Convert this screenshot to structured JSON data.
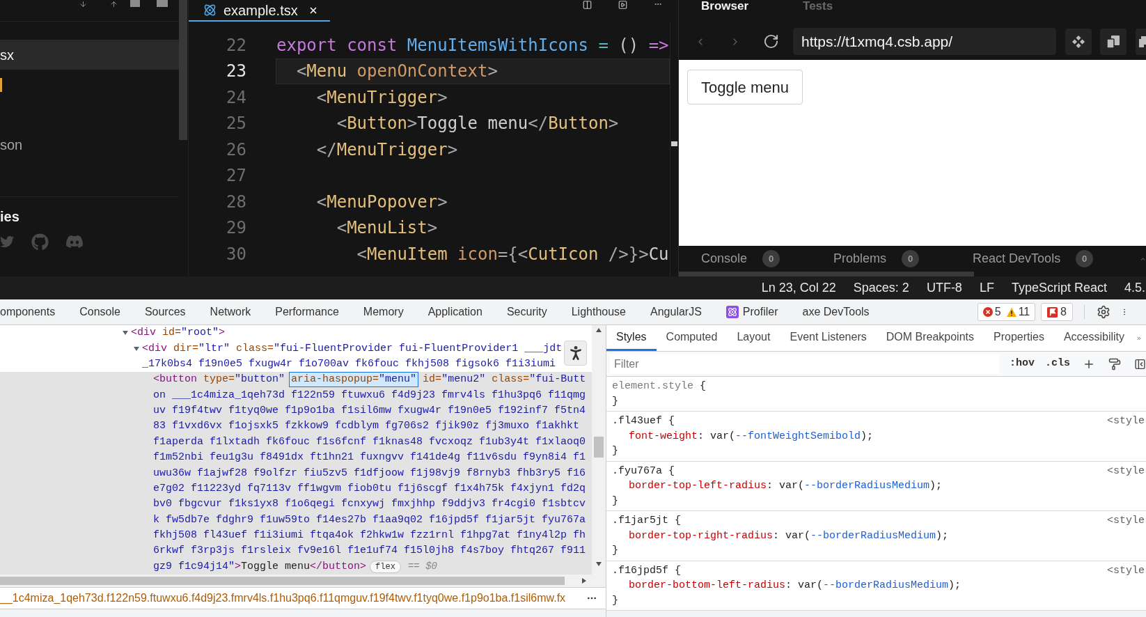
{
  "sidebar": {
    "files": [
      {
        "label": "sx",
        "selected": true
      },
      {
        "label": "son",
        "selected": false
      }
    ],
    "section_title": "ies"
  },
  "editor": {
    "tabs": [
      {
        "label": "example.tsx",
        "selected": true
      }
    ],
    "lines": [
      {
        "number": "22",
        "current": false,
        "tokens": [
          {
            "kind": "keyword",
            "text": "export const "
          },
          {
            "kind": "function",
            "text": "MenuItemsWithIcons"
          },
          {
            "kind": "operator",
            "text": " = "
          },
          {
            "kind": "plain",
            "text": "() "
          },
          {
            "kind": "keyword",
            "text": "=>"
          }
        ]
      },
      {
        "number": "23",
        "current": true,
        "tokens": [
          {
            "kind": "punct",
            "text": "  <"
          },
          {
            "kind": "component",
            "text": "Menu"
          },
          {
            "kind": "attribute",
            "text": " openOnContext"
          },
          {
            "kind": "punct",
            "text": ">"
          }
        ]
      },
      {
        "number": "24",
        "current": false,
        "tokens": [
          {
            "kind": "punct",
            "text": "    <"
          },
          {
            "kind": "component",
            "text": "MenuTrigger"
          },
          {
            "kind": "punct",
            "text": ">"
          }
        ]
      },
      {
        "number": "25",
        "current": false,
        "tokens": [
          {
            "kind": "punct",
            "text": "      <"
          },
          {
            "kind": "component",
            "text": "Button"
          },
          {
            "kind": "punct",
            "text": ">"
          },
          {
            "kind": "text",
            "text": "Toggle menu"
          },
          {
            "kind": "punct",
            "text": "</"
          },
          {
            "kind": "component",
            "text": "Button"
          },
          {
            "kind": "punct",
            "text": ">"
          }
        ]
      },
      {
        "number": "26",
        "current": false,
        "tokens": [
          {
            "kind": "punct",
            "text": "    </"
          },
          {
            "kind": "component",
            "text": "MenuTrigger"
          },
          {
            "kind": "punct",
            "text": ">"
          }
        ]
      },
      {
        "number": "27",
        "current": false
      },
      {
        "number": "28",
        "current": false,
        "tokens": [
          {
            "kind": "punct",
            "text": "    <"
          },
          {
            "kind": "component",
            "text": "MenuPopover"
          },
          {
            "kind": "punct",
            "text": ">"
          }
        ]
      },
      {
        "number": "29",
        "current": false,
        "tokens": [
          {
            "kind": "punct",
            "text": "      <"
          },
          {
            "kind": "component",
            "text": "MenuList"
          },
          {
            "kind": "punct",
            "text": ">"
          }
        ]
      },
      {
        "number": "30",
        "current": false,
        "tokens": [
          {
            "kind": "punct",
            "text": "        <"
          },
          {
            "kind": "component",
            "text": "MenuItem"
          },
          {
            "kind": "attribute",
            "text": " icon"
          },
          {
            "kind": "punct",
            "text": "={<"
          },
          {
            "kind": "component",
            "text": "CutIcon"
          },
          {
            "kind": "punct",
            "text": " />}>"
          },
          {
            "kind": "text",
            "text": "Cu"
          }
        ]
      }
    ]
  },
  "browser": {
    "tabs": [
      {
        "label": "Browser",
        "selected": true
      },
      {
        "label": "Tests",
        "selected": false
      }
    ],
    "url": "https://t1xmq4.csb.app/",
    "page_button": "Toggle menu",
    "panel_tabs": [
      {
        "label": "Console",
        "count": "0"
      },
      {
        "label": "Problems",
        "count": "0"
      },
      {
        "label": "React DevTools",
        "count": "0"
      }
    ]
  },
  "status_bar": [
    "Ln 23, Col 22",
    "Spaces: 2",
    "UTF-8",
    "LF",
    "TypeScript React",
    "4.5."
  ],
  "devtools": {
    "tabs": [
      {
        "label": "omponents",
        "kind": "plain"
      },
      {
        "label": "Console",
        "kind": "plain"
      },
      {
        "label": "Sources",
        "kind": "plain"
      },
      {
        "label": "Network",
        "kind": "plain"
      },
      {
        "label": "Performance",
        "kind": "plain"
      },
      {
        "label": "Memory",
        "kind": "plain"
      },
      {
        "label": "Application",
        "kind": "plain"
      },
      {
        "label": "Security",
        "kind": "plain"
      },
      {
        "label": "Lighthouse",
        "kind": "plain"
      },
      {
        "label": "AngularJS",
        "kind": "plain"
      },
      {
        "label": "Profiler",
        "kind": "with_icon"
      },
      {
        "label": "axe DevTools",
        "kind": "plain"
      }
    ],
    "counters": {
      "errors": "5",
      "warnings": "11",
      "issues": "8"
    }
  },
  "elements": {
    "dom_tree": [
      {
        "expanded": true,
        "selected": false,
        "lines": [
          "<div id=\"root\">"
        ],
        "children": [
          {
            "expanded": true,
            "selected": false,
            "lines": [
              "<div dir=\"ltr\" class=\"fui-FluentProvider fui-FluentProvider1 ___jdt",
              "_17k0bs4 f19n0e5 fxugw4r f1o700av fk6fouc fkhj508 figsok6 f1i3iumi"
            ],
            "children": [
              {
                "selected": true,
                "lines": [
                  [
                    {
                      "text": "<button type=\"button\"",
                      "highlighted": false
                    },
                    {
                      "text": "aria-haspopup=\"menu\"",
                      "highlighted": true
                    },
                    {
                      "text": "id=\"menu2\" class=\"fui-Butt",
                      "highlighted": false
                    }
                  ],
                  "on ___1c4miza_1qeh73d f122n59 ftuwxu6 f4d9j23 fmrv4ls f1hu3pq6 f11qmg",
                  "uv f19f4twv f1tyq0we f1p9o1ba f1sil6mw fxugw4r f19n0e5 f192inf7 f5tn4",
                  "83 f1vxd6vx f1ojsxk5 fzkkow9 fcdblym fg706s2 fjik90z fj3muxo f1akhkt",
                  "f1aperda f1lxtadh fk6fouc f1s6fcnf f1knas48 fvcxoqz f1ub3y4t f1xlaoq0",
                  "f1m52nbi feu1g3u f8491dx ft1hn21 fuxngvv f141de4g f11v6sdu f9yn8i4 f1",
                  "uwu36w f1ajwf28 f9olfzr fiu5zv5 f1dfjoow f1j98vj9 f8rnyb3 fhb3ry5 f16",
                  "e7g02 f11223yd fq7113v ff1wgvm fiob0tu f1j6scgf f1x4h75k f4xjyn1 fd2q",
                  "bv0 fbgcvur f1ks1yx8 f1o6qegi fcnxywj fmxjhhp f9ddjv3 fr4cgi0 f1sbtcv",
                  "k fw5db7e fdghr9 f1uw59to f14es27b f1aa9q02 f16jpd5f f1jar5jt fyu767a",
                  "fkhj508 fl43uef f1i3iumi ftqa4ok f2hkw1w fzz1rnl f1hpg7at f1ny4l2p fh",
                  "6rkwf f3rp3js f1rsleix fv9e16l f1e1uf74 f15l0jh8 f4s7boy fhtq267 f911",
                  "gz9 f1c94j14\">Toggle menu</button>"
                ],
                "badge": "flex",
                "suffix": "== *$0*"
              }
            ]
          }
        ]
      }
    ],
    "breadcrumb": "__1c4miza_1qeh73d.f122n59.ftuwxu6.f4d9j23.fmrv4ls.f1hu3pq6.f11qmguv.f19f4twv.f1tyq0we.f1p9o1ba.f1sil6mw.fx"
  },
  "styles": {
    "tabs": [
      {
        "label": "Styles",
        "selected": true
      },
      {
        "label": "Computed",
        "selected": false
      },
      {
        "label": "Layout",
        "selected": false
      },
      {
        "label": "Event Listeners",
        "selected": false
      },
      {
        "label": "DOM Breakpoints",
        "selected": false
      },
      {
        "label": "Properties",
        "selected": false
      },
      {
        "label": "Accessibility",
        "selected": false
      }
    ],
    "filter": {
      "placeholder": "Filter"
    },
    "toggles": [
      ":hov",
      ".cls"
    ],
    "rules": [
      {
        "kind": "inline",
        "selector": "element.style {",
        "close": "}"
      },
      {
        "kind": "class",
        "selector": ".fl43uef {",
        "source": "<style",
        "declarations": [
          "font-weight: var(--fontWeightSemibold);"
        ],
        "close": "}"
      },
      {
        "kind": "class",
        "selector": ".fyu767a {",
        "source": "<style",
        "declarations": [
          "border-top-left-radius: var(--borderRadiusMedium);"
        ],
        "close": "}"
      },
      {
        "kind": "class",
        "selector": ".f1jar5jt {",
        "source": "<style",
        "declarations": [
          "border-top-right-radius: var(--borderRadiusMedium);"
        ],
        "close": "}"
      },
      {
        "kind": "class",
        "selector": ".f16jpd5f {",
        "source": "<style",
        "declarations": [
          "border-bottom-left-radius: var(--borderRadiusMedium);"
        ],
        "close": "}"
      }
    ]
  }
}
